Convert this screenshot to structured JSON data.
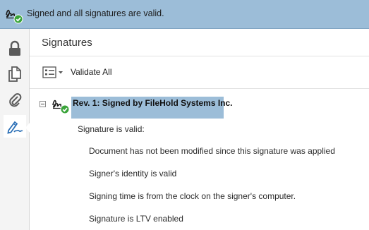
{
  "banner": {
    "message": "Signed and all signatures are valid.",
    "icon": "valid-signature-icon"
  },
  "rail": {
    "items": [
      {
        "name": "lock-icon",
        "active": false
      },
      {
        "name": "pages-icon",
        "active": false
      },
      {
        "name": "attachments-icon",
        "active": false
      },
      {
        "name": "signature-pen-icon",
        "active": true
      }
    ]
  },
  "panel": {
    "title": "Signatures",
    "toolbar": {
      "options_icon": "list-options-icon",
      "validate_all_label": "Validate All"
    },
    "signature": {
      "label": "Rev. 1: Signed by FileHold Systems Inc.",
      "status_label": "Signature is valid:",
      "details": [
        "Document has not been modified since this signature was applied",
        "Signer's identity is valid",
        "Signing time is from the clock on the signer's computer.",
        "Signature is LTV enabled"
      ]
    }
  },
  "colors": {
    "banner_bg": "#9cbdd8",
    "selection_bg": "#9cbdd8",
    "valid_green": "#3aa43a",
    "active_icon_blue": "#2a6fb6"
  }
}
